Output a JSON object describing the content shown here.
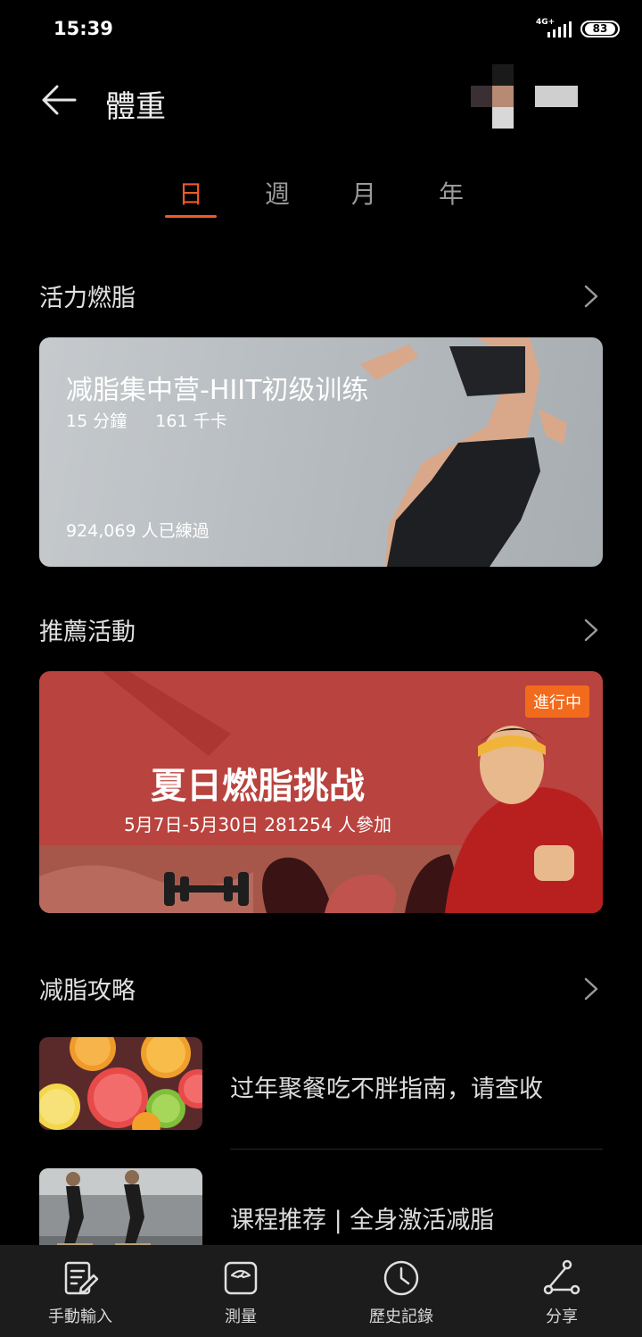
{
  "status": {
    "time": "15:39",
    "network": "4G+",
    "battery": "83"
  },
  "header": {
    "title": "體重"
  },
  "tabs": [
    {
      "label": "日",
      "active": true
    },
    {
      "label": "週",
      "active": false
    },
    {
      "label": "月",
      "active": false
    },
    {
      "label": "年",
      "active": false
    }
  ],
  "sections": {
    "workout": {
      "title": "活力燃脂"
    },
    "events": {
      "title": "推薦活動"
    },
    "guides": {
      "title": "减脂攻略"
    }
  },
  "workout_card": {
    "title": "减脂集中营-HIIT初级训练",
    "duration": "15 分鐘",
    "calories": "161 千卡",
    "trained": "924,069 人已練過"
  },
  "event_card": {
    "badge": "進行中",
    "title": "夏日燃脂挑战",
    "subtitle": "5月7日-5月30日  281254 人參加"
  },
  "articles": [
    {
      "title": "过年聚餐吃不胖指南，请查收",
      "icon": "citrus-fruit-image"
    },
    {
      "title": "课程推荐 | 全身激活减脂",
      "icon": "gym-workout-image"
    }
  ],
  "bottom_nav": [
    {
      "label": "手動輸入",
      "icon": "edit-note-icon"
    },
    {
      "label": "測量",
      "icon": "scale-icon"
    },
    {
      "label": "歷史記錄",
      "icon": "clock-icon"
    },
    {
      "label": "分享",
      "icon": "share-icon"
    }
  ],
  "colors": {
    "accent": "#f05a2a",
    "badge": "#f26b1d",
    "event_bg": "#b9433e"
  }
}
